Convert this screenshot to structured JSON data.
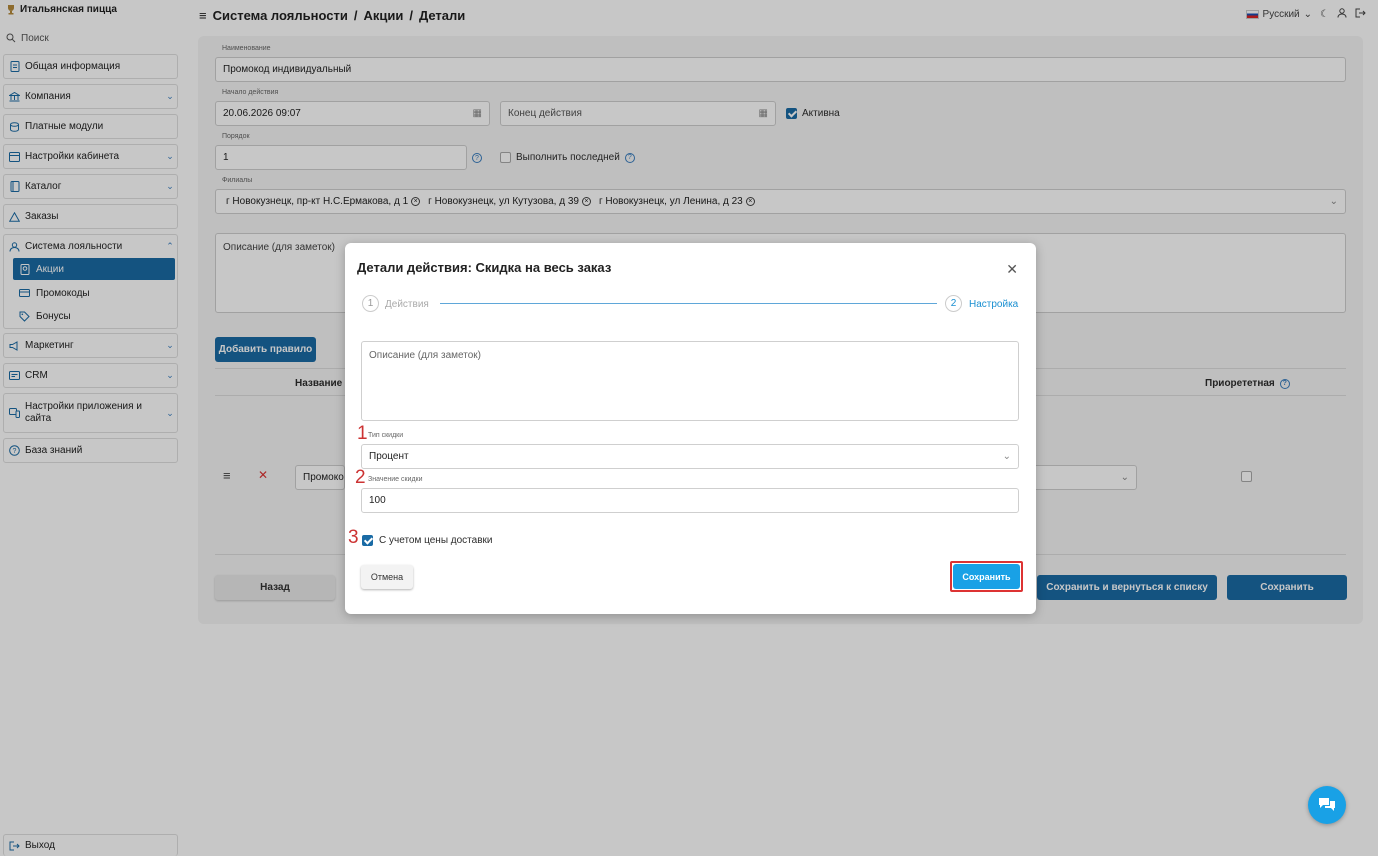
{
  "brand": {
    "name": "Итальянская пицца"
  },
  "search": {
    "label": "Поиск"
  },
  "sidebar": {
    "items": [
      {
        "label": "Общая информация",
        "icon": "document-icon"
      },
      {
        "label": "Компания",
        "icon": "bank-icon"
      },
      {
        "label": "Платные модули",
        "icon": "coins-icon"
      },
      {
        "label": "Настройки кабинета",
        "icon": "settings-icon"
      },
      {
        "label": "Каталог",
        "icon": "book-icon"
      },
      {
        "label": "Заказы",
        "icon": "triangle-icon"
      },
      {
        "label": "Система лояльности",
        "icon": "loyalty-icon"
      },
      {
        "label": "Маркетинг",
        "icon": "megaphone-icon"
      },
      {
        "label": "CRM",
        "icon": "crm-icon"
      },
      {
        "label": "Настройки приложения и сайта",
        "icon": "device-icon"
      },
      {
        "label": "База знаний",
        "icon": "help-icon"
      }
    ],
    "sub": [
      {
        "label": "Акции",
        "icon": "badge-icon"
      },
      {
        "label": "Промокоды",
        "icon": "ticket-icon"
      },
      {
        "label": "Бонусы",
        "icon": "tag-icon"
      }
    ],
    "logout": "Выход"
  },
  "header": {
    "crumb1": "Система лояльности",
    "sep": "/",
    "crumb2": "Акции",
    "crumb3": "Детали",
    "language": "Русский"
  },
  "form": {
    "name_label": "Наименование",
    "name_value": "Промокод индивидуальный",
    "start_label": "Начало действия",
    "start_value": "20.06.2026 09:07",
    "end_placeholder": "Конец действия",
    "active_label": "Активна",
    "order_label": "Порядок",
    "order_value": "1",
    "execute_last_label": "Выполнить последней",
    "branches_label": "Филиалы",
    "branches": [
      "г Новокузнецк, пр-кт Н.С.Ермакова, д 1",
      "г Новокузнецк, ул Кутузова, д 39",
      "г Новокузнецк, ул Ленина, д 23"
    ],
    "description_placeholder": "Описание (для заметок)",
    "add_rule": "Добавить правило",
    "col_name": "Название",
    "col_priority": "Приорететная",
    "row_value": "Промоко",
    "back": "Назад",
    "save_return": "Сохранить и вернуться к списку",
    "save": "Сохранить"
  },
  "modal": {
    "title": "Детали действия: Скидка на весь заказ",
    "step1_num": "1",
    "step1_label": "Действия",
    "step2_num": "2",
    "step2_label": "Настройка",
    "description_placeholder": "Описание (для заметок)",
    "discount_type_label": "Тип скидки",
    "discount_type_value": "Процент",
    "discount_value_label": "Значение скидки",
    "discount_value": "100",
    "delivery_label": "С учетом цены доставки",
    "cancel": "Отмена",
    "save": "Сохранить",
    "marker1": "1",
    "marker2": "2",
    "marker3": "3"
  }
}
